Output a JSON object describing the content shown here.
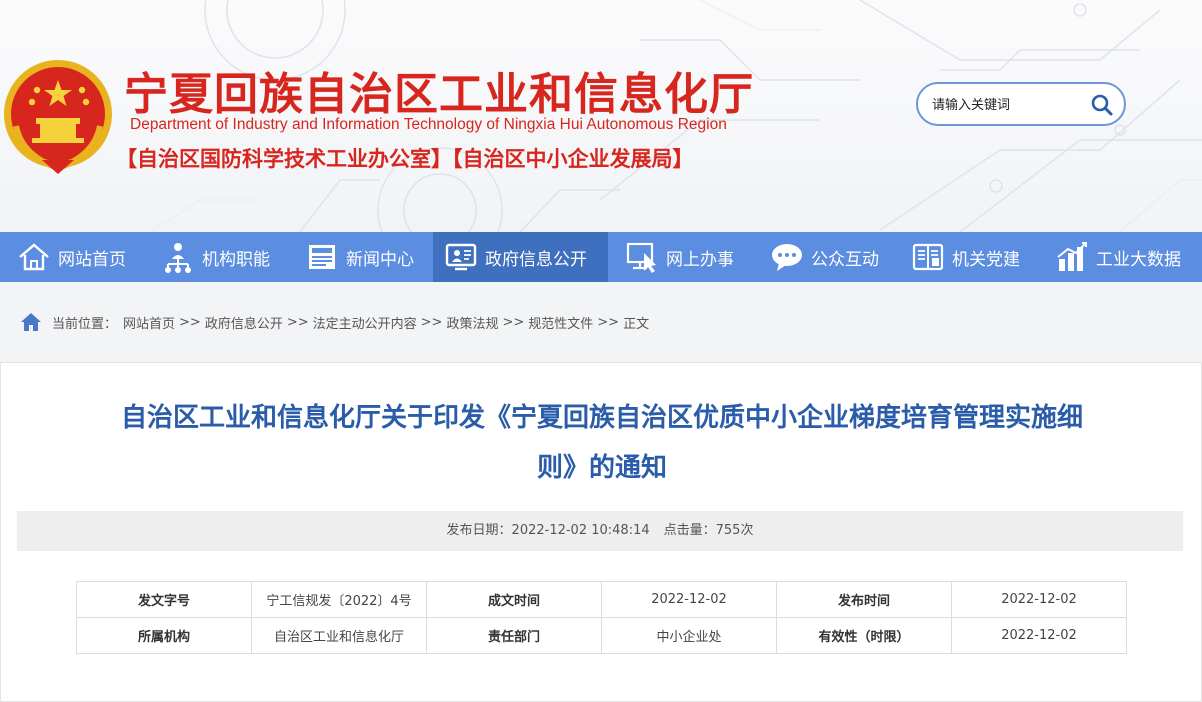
{
  "header": {
    "title_cn": "宁夏回族自治区工业和信息化厅",
    "title_en": "Department of Industry and Information Technology of Ningxia Hui Autonomous Region",
    "subtitle": "【自治区国防科学技术工业办公室】【自治区中小企业发展局】",
    "search_placeholder": "请输入关键词"
  },
  "nav": {
    "items": [
      {
        "label": "网站首页",
        "icon": "home-icon"
      },
      {
        "label": "机构职能",
        "icon": "org-chart-icon"
      },
      {
        "label": "新闻中心",
        "icon": "news-icon"
      },
      {
        "label": "政府信息公开",
        "icon": "gov-info-icon",
        "active": true
      },
      {
        "label": "网上办事",
        "icon": "online-service-icon"
      },
      {
        "label": "公众互动",
        "icon": "chat-bubble-icon"
      },
      {
        "label": "机关党建",
        "icon": "party-building-icon"
      },
      {
        "label": "工业大数据",
        "icon": "bar-chart-icon"
      }
    ]
  },
  "breadcrumb": {
    "prefix": "当前位置：",
    "items": [
      "网站首页",
      "政府信息公开",
      "法定主动公开内容",
      "政策法规",
      "规范性文件",
      "正文"
    ],
    "separator": ">>"
  },
  "article": {
    "title_line1": "自治区工业和信息化厅关于印发《宁夏回族自治区优质中小企业梯度培育管理实施细",
    "title_line2": "则》的通知",
    "publish_date": "发布日期：2022-12-02 10:48:14",
    "views": "点击量：755次"
  },
  "info_table": {
    "rows": [
      [
        "发文字号",
        "宁工信规发〔2022〕4号",
        "成文时间",
        "2022-12-02",
        "发布时间",
        "2022-12-02"
      ],
      [
        "所属机构",
        "自治区工业和信息化厅",
        "责任部门",
        "中小企业处",
        "有效性（时限）",
        "2022-12-02"
      ]
    ]
  },
  "colors": {
    "brand_red": "#d7261e",
    "nav_blue": "#5b8de0",
    "nav_active": "#3f6fbf",
    "title_blue": "#2a5caa"
  }
}
